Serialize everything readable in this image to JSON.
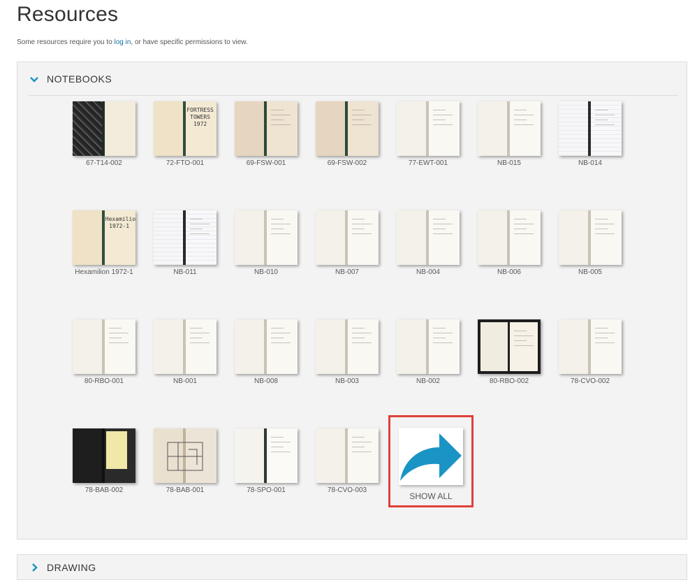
{
  "page": {
    "title": "Resources",
    "intro_prefix": "Some resources require you to ",
    "intro_link": "log in",
    "intro_suffix": ", or have specific permissions to view."
  },
  "sections": {
    "notebooks": {
      "title": "NOTEBOOKS"
    },
    "drawing": {
      "title": "DRAWING"
    }
  },
  "notebooks": [
    {
      "caption": "67-T14-002",
      "style": "marble"
    },
    {
      "caption": "72-FTO-001",
      "style": "cream",
      "cover_text": "FORTRESS TOWERS 1972"
    },
    {
      "caption": "69-FSW-001",
      "style": "tan"
    },
    {
      "caption": "69-FSW-002",
      "style": "tan"
    },
    {
      "caption": "77-EWT-001",
      "style": "white"
    },
    {
      "caption": "NB-015",
      "style": "white"
    },
    {
      "caption": "NB-014",
      "style": "grid"
    },
    {
      "caption": "Hexamilion 1972-1",
      "style": "cream",
      "cover_text": "Hexamilion 1972-1"
    },
    {
      "caption": "NB-011",
      "style": "grid"
    },
    {
      "caption": "NB-010",
      "style": "white"
    },
    {
      "caption": "NB-007",
      "style": "white"
    },
    {
      "caption": "NB-004",
      "style": "white"
    },
    {
      "caption": "NB-006",
      "style": "white"
    },
    {
      "caption": "NB-005",
      "style": "white"
    },
    {
      "caption": "80-RBO-001",
      "style": "white"
    },
    {
      "caption": "NB-001",
      "style": "white"
    },
    {
      "caption": "NB-008",
      "style": "white"
    },
    {
      "caption": "NB-003",
      "style": "white"
    },
    {
      "caption": "NB-002",
      "style": "white"
    },
    {
      "caption": "80-RBO-002",
      "style": "dark-frame"
    },
    {
      "caption": "78-CVO-002",
      "style": "white"
    },
    {
      "caption": "78-BAB-002",
      "style": "black"
    },
    {
      "caption": "78-BAB-001",
      "style": "plan"
    },
    {
      "caption": "78-SPO-001",
      "style": "white-dark"
    },
    {
      "caption": "78-CVO-003",
      "style": "white"
    }
  ],
  "show_all": {
    "label": "SHOW ALL",
    "icon": "share-arrow-icon",
    "icon_color": "#1a94c4"
  },
  "colors": {
    "accent": "#1a94c4",
    "highlight_border": "#e0403b",
    "link": "#1a6fa8"
  }
}
